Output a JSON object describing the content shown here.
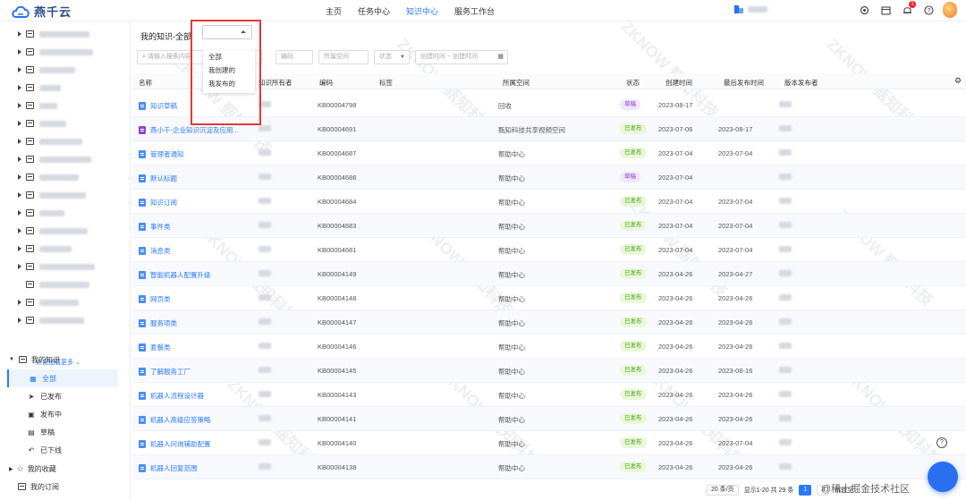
{
  "app": {
    "name": "燕千云"
  },
  "nav": [
    "主页",
    "任务中心",
    "知识中心",
    "服务工作台"
  ],
  "nav_active": "知识中心",
  "header": {
    "notification_count": "1"
  },
  "sidebar": {
    "load_more": "点击加载更多",
    "my_knowledge": "我的知识",
    "sub_items": [
      {
        "label": "全部",
        "icon": "grid-icon"
      },
      {
        "label": "已发布",
        "icon": "send-icon"
      },
      {
        "label": "发布中",
        "icon": "image-icon"
      },
      {
        "label": "草稿",
        "icon": "draft-icon"
      },
      {
        "label": "已下线",
        "icon": "undo-icon"
      }
    ],
    "favorites": "我的收藏",
    "subscriptions": "我的订阅"
  },
  "main": {
    "title": "我的知识-全部",
    "dropdown_options": [
      "全部",
      "我创建的",
      "我发布的"
    ],
    "filters": {
      "search_placeholder": "请输入搜索内容",
      "code": "编码",
      "space": "所属空间",
      "status": "状态",
      "created_start": "创建时间",
      "created_end": "创建时间"
    },
    "columns": [
      "名称",
      "知识所有者",
      "编码",
      "标签",
      "所属空间",
      "状态",
      "创建时间",
      "最后发布时间",
      "版本发布者"
    ],
    "rows": [
      {
        "name": "知识草稿",
        "code": "KB00004798",
        "space": "回收",
        "status": "草稿",
        "created": "2023-08-17",
        "published": ""
      },
      {
        "name": "燕小千-企业知识沉淀及应用...",
        "code": "KB00004691",
        "space": "甄知科技共享视频空间",
        "status": "已发布",
        "created": "2023-07-06",
        "published": "2023-08-17"
      },
      {
        "name": "管理者通知",
        "code": "KB00004687",
        "space": "帮助中心",
        "status": "已发布",
        "created": "2023-07-04",
        "published": "2023-07-04"
      },
      {
        "name": "默认标题",
        "code": "KB00004686",
        "space": "帮助中心",
        "status": "草稿",
        "created": "2023-07-04",
        "published": ""
      },
      {
        "name": "知识订阅",
        "code": "KB00004684",
        "space": "帮助中心",
        "status": "已发布",
        "created": "2023-07-04",
        "published": "2023-07-04"
      },
      {
        "name": "事件类",
        "code": "KB00004683",
        "space": "帮助中心",
        "status": "已发布",
        "created": "2023-07-04",
        "published": "2023-07-04"
      },
      {
        "name": "消息类",
        "code": "KB00004681",
        "space": "帮助中心",
        "status": "已发布",
        "created": "2023-07-04",
        "published": "2023-07-04"
      },
      {
        "name": "智能机器人配置升级",
        "code": "KB00004149",
        "space": "帮助中心",
        "status": "已发布",
        "created": "2023-04-26",
        "published": "2023-04-27"
      },
      {
        "name": "网页类",
        "code": "KB00004148",
        "space": "帮助中心",
        "status": "已发布",
        "created": "2023-04-26",
        "published": "2023-04-26"
      },
      {
        "name": "服务项类",
        "code": "KB00004147",
        "space": "帮助中心",
        "status": "已发布",
        "created": "2023-04-26",
        "published": "2023-04-26"
      },
      {
        "name": "套餐类",
        "code": "KB00004146",
        "space": "帮助中心",
        "status": "已发布",
        "created": "2023-04-26",
        "published": "2023-04-26"
      },
      {
        "name": "了解服务工厂",
        "code": "KB00004145",
        "space": "帮助中心",
        "status": "已发布",
        "created": "2023-04-26",
        "published": "2023-08-16"
      },
      {
        "name": "机器人流程设计器",
        "code": "KB00004143",
        "space": "帮助中心",
        "status": "已发布",
        "created": "2023-04-26",
        "published": "2023-04-26"
      },
      {
        "name": "机器人高级应答策略",
        "code": "KB00004141",
        "space": "帮助中心",
        "status": "已发布",
        "created": "2023-04-26",
        "published": "2023-04-26"
      },
      {
        "name": "机器人问询辅助配置",
        "code": "KB00004140",
        "space": "帮助中心",
        "status": "已发布",
        "created": "2023-04-26",
        "published": "2023-07-04"
      },
      {
        "name": "机器人回复范围",
        "code": "KB00004138",
        "space": "帮助中心",
        "status": "已发布",
        "created": "2023-04-26",
        "published": "2023-04-26"
      }
    ]
  },
  "pagination": {
    "page_size": "20 条/页",
    "summary": "显示1-20 共 29 条",
    "current": "1",
    "next": "2",
    "goto": "跳转至"
  },
  "watermark": {
    "text": "ZKNOW",
    "cn": "甄知科技",
    "corner": "@稀土掘金技术社区"
  },
  "colors": {
    "accent": "#2979ff",
    "published_bg": "#e9f8d9",
    "draft_bg": "#f1e6fb",
    "highlight": "#e53935"
  }
}
